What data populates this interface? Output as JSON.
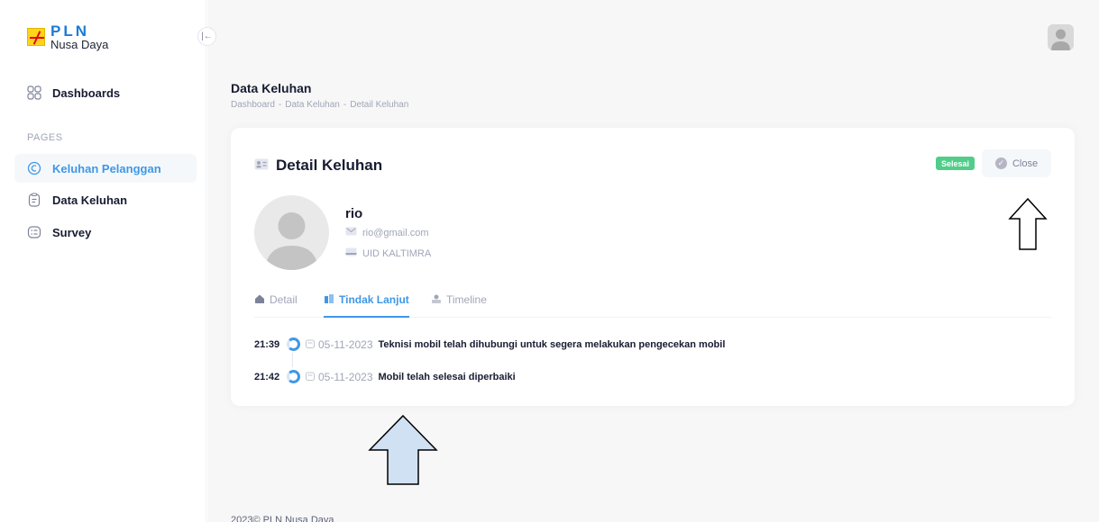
{
  "brand": {
    "title": "PLN",
    "subtitle": "Nusa Daya"
  },
  "sidebar": {
    "collapse_icon": "collapse-left-icon",
    "dashboards_label": "Dashboards",
    "section_label": "PAGES",
    "items": [
      {
        "label": "Keluhan Pelanggan",
        "icon": "complaint-icon",
        "active": true
      },
      {
        "label": "Data Keluhan",
        "icon": "clipboard-icon",
        "active": false
      },
      {
        "label": "Survey",
        "icon": "survey-icon",
        "active": false
      }
    ]
  },
  "header": {
    "page_title": "Data Keluhan",
    "breadcrumb": [
      "Dashboard",
      "-",
      "Data Keluhan",
      "-",
      "Detail Keluhan"
    ]
  },
  "card": {
    "title": "Detail Keluhan",
    "status": "Selesai",
    "close_label": "Close",
    "profile": {
      "name": "rio",
      "email": "rio@gmail.com",
      "unit": "UID KALTIMRA"
    },
    "tabs": [
      {
        "label": "Detail",
        "icon": "home-icon",
        "active": false
      },
      {
        "label": "Tindak Lanjut",
        "icon": "followup-icon",
        "active": true
      },
      {
        "label": "Timeline",
        "icon": "timeline-icon",
        "active": false
      }
    ],
    "timeline": [
      {
        "time": "21:39",
        "date": "05-11-2023",
        "text": "Teknisi mobil telah dihubungi untuk segera melakukan pengecekan mobil"
      },
      {
        "time": "21:42",
        "date": "05-11-2023",
        "text": "Mobil telah selesai diperbaiki"
      }
    ]
  },
  "footer": {
    "text": "2023© PLN Nusa Daya"
  },
  "colors": {
    "accent": "#3f97e6",
    "success": "#50cd89",
    "arrow_fill": "#d0e1f3"
  }
}
